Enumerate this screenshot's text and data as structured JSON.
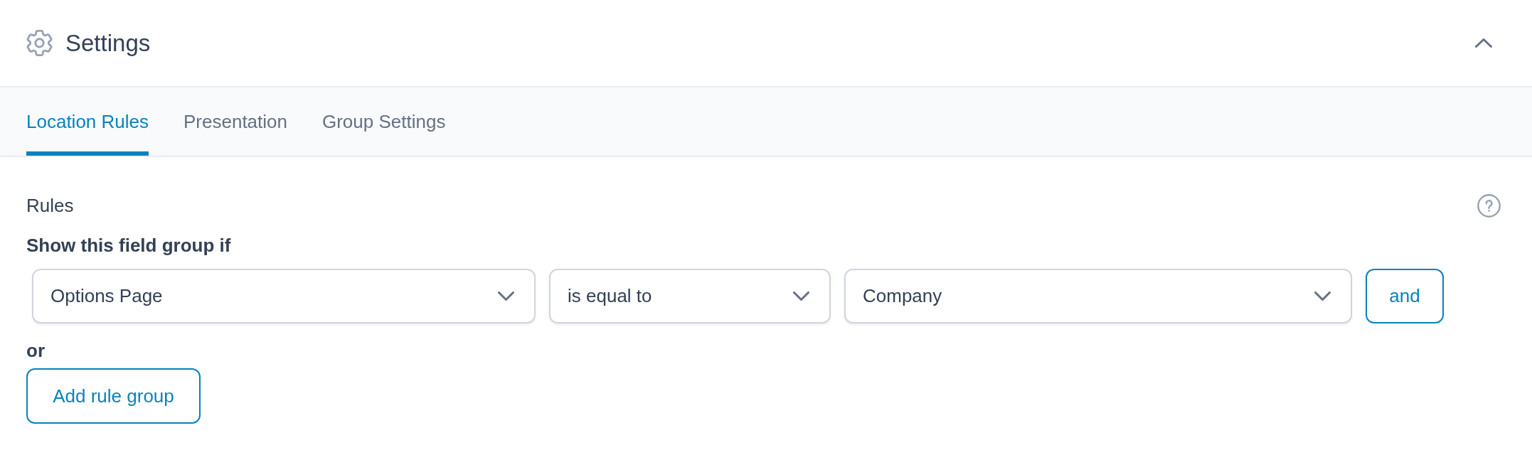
{
  "header": {
    "title": "Settings",
    "expanded": true
  },
  "tabs": [
    {
      "label": "Location Rules",
      "selected": true
    },
    {
      "label": "Presentation",
      "selected": false
    },
    {
      "label": "Group Settings",
      "selected": false
    }
  ],
  "location_rules": {
    "label": "Rules",
    "heading": "Show this field group if",
    "rule_group": {
      "selects": [
        {
          "value": "Options Page"
        },
        {
          "value": "is equal to"
        },
        {
          "value": "Company"
        }
      ],
      "and_button": "and"
    },
    "or_label": "or",
    "add_group_button": "Add rule group"
  }
}
